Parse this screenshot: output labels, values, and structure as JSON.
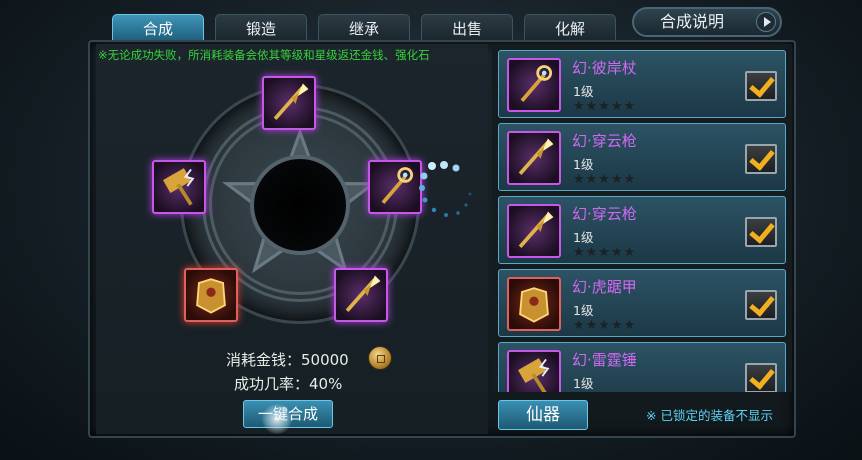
{
  "tabs": [
    {
      "label": "合成",
      "active": true
    },
    {
      "label": "锻造",
      "active": false
    },
    {
      "label": "继承",
      "active": false
    },
    {
      "label": "出售",
      "active": false
    },
    {
      "label": "化解",
      "active": false
    }
  ],
  "help_button": {
    "label": "合成说明",
    "icon": "play-arrow-icon"
  },
  "notice": "※无论成功失败，所消耗装备会依其等级和星级返还金钱、强化石",
  "synthesis": {
    "slots": [
      {
        "name": "slot-top",
        "item": "spear-icon",
        "quality": "purple"
      },
      {
        "name": "slot-left",
        "item": "hammer-icon",
        "quality": "purple"
      },
      {
        "name": "slot-right",
        "item": "staff-icon",
        "quality": "purple"
      },
      {
        "name": "slot-bottom-left",
        "item": "armor-icon",
        "quality": "red"
      },
      {
        "name": "slot-bottom-right",
        "item": "spear-icon",
        "quality": "purple"
      }
    ],
    "cost_label": "消耗金钱：50000",
    "rate_label": "成功几率：40%",
    "fuse_button": "一键合成"
  },
  "equipment_list": [
    {
      "name": "幻·彼岸杖",
      "level": "1级",
      "stars_lit": 0,
      "stars_total": 5,
      "icon": "staff-icon",
      "quality": "purple",
      "checked": true
    },
    {
      "name": "幻·穿云枪",
      "level": "1级",
      "stars_lit": 0,
      "stars_total": 5,
      "icon": "spear-icon",
      "quality": "purple",
      "checked": true
    },
    {
      "name": "幻·穿云枪",
      "level": "1级",
      "stars_lit": 0,
      "stars_total": 5,
      "icon": "spear-icon",
      "quality": "purple",
      "checked": true
    },
    {
      "name": "幻·虎踞甲",
      "level": "1级",
      "stars_lit": 0,
      "stars_total": 5,
      "icon": "armor-icon",
      "quality": "red",
      "checked": true
    },
    {
      "name": "幻·雷霆锤",
      "level": "1级",
      "stars_lit": 0,
      "stars_total": 5,
      "icon": "hammer-icon",
      "quality": "purple",
      "checked": true
    }
  ],
  "filter_button": "仙器",
  "locked_note": "※ 已锁定的装备不显示",
  "colors": {
    "accent": "#3a8fb2",
    "notice_green": "#37d23c",
    "item_purple": "#d168f4",
    "check_gold": "#f2b020",
    "note_cyan": "#5fd2f5"
  }
}
